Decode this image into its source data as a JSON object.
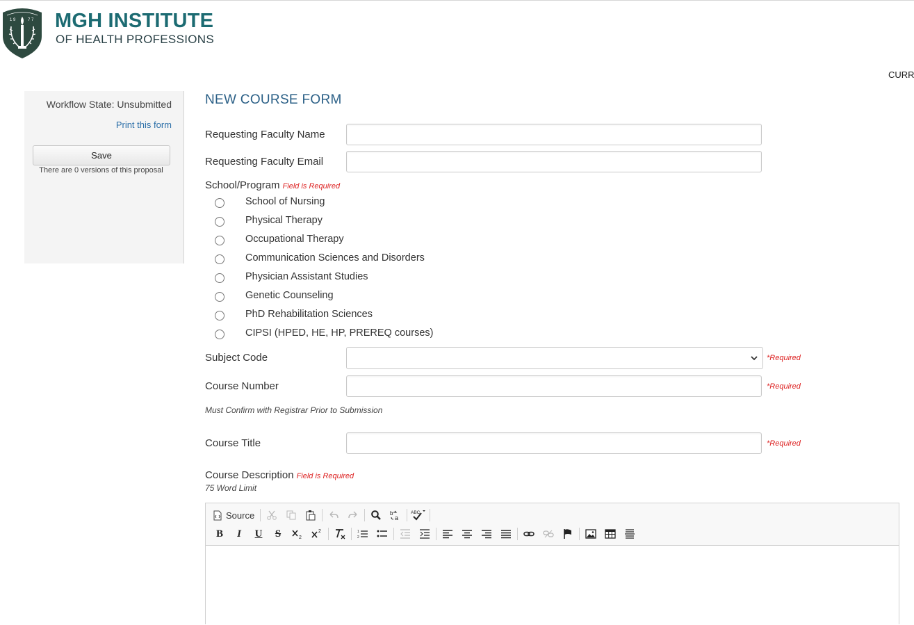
{
  "header": {
    "logo_title": "MGH INSTITUTE",
    "logo_subtitle": "OF HEALTH PROFESSIONS",
    "logo_year": "1977",
    "nav_partial": "CURR"
  },
  "sidebar": {
    "workflow_state": "Workflow State: Unsubmitted",
    "print_link": "Print this form",
    "save_label": "Save",
    "versions_text": "There are 0 versions of this proposal"
  },
  "form": {
    "title": "NEW COURSE FORM",
    "faculty_name": {
      "label": "Requesting Faculty Name",
      "value": ""
    },
    "faculty_email": {
      "label": "Requesting Faculty Email",
      "value": ""
    },
    "school": {
      "label": "School/Program",
      "required_note": "Field is Required",
      "options": [
        "School of Nursing",
        "Physical Therapy",
        "Occupational Therapy",
        "Communication Sciences and Disorders",
        "Physician Assistant Studies",
        "Genetic Counseling",
        "PhD Rehabilitation Sciences",
        "CIPSI (HPED, HE, HP, PREREQ courses)"
      ]
    },
    "subject_code": {
      "label": "Subject Code",
      "value": "",
      "required": "*Required"
    },
    "course_number": {
      "label": "Course Number",
      "value": "",
      "required": "*Required",
      "help": "Must Confirm with Registrar Prior to Submission"
    },
    "course_title": {
      "label": "Course Title",
      "value": "",
      "required": "*Required"
    },
    "course_description": {
      "label": "Course Description",
      "required_note": "Field is Required",
      "help": "75 Word Limit"
    }
  },
  "editor": {
    "source_label": "Source",
    "row1_icons": [
      "source-icon",
      "cut-icon",
      "copy-icon",
      "paste-icon",
      "undo-icon",
      "redo-icon",
      "find-icon",
      "replace-icon",
      "spellcheck-icon"
    ],
    "row2_icons": [
      "bold-icon",
      "italic-icon",
      "underline-icon",
      "strikethrough-icon",
      "subscript-icon",
      "superscript-icon",
      "remove-format-icon",
      "numbered-list-icon",
      "bulleted-list-icon",
      "outdent-icon",
      "indent-icon",
      "align-left-icon",
      "align-center-icon",
      "align-right-icon",
      "justify-icon",
      "link-icon",
      "unlink-icon",
      "anchor-icon",
      "image-icon",
      "table-icon",
      "horizontal-rule-icon"
    ]
  },
  "colors": {
    "brand": "#1c6b72",
    "title": "#2a5f86",
    "link": "#2c6fa8",
    "required": "#d22222"
  }
}
